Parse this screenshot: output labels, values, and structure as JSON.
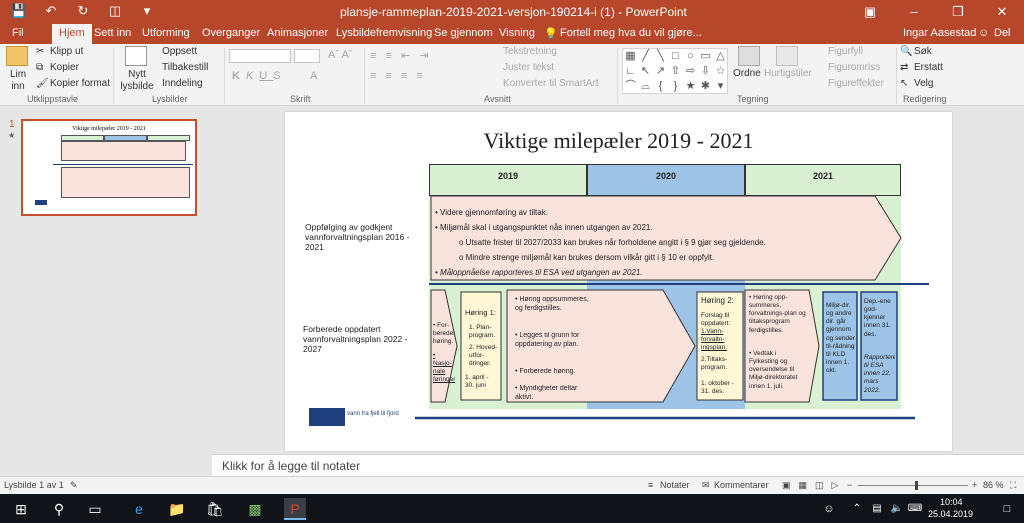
{
  "titlebar": {
    "title": "plansje-rammeplan-2019-2021-versjon-190214-i (1) - PowerPoint",
    "qat": [
      "save-icon",
      "undo-icon",
      "redo-icon",
      "slideshow-icon",
      "more-icon"
    ],
    "user": "Ingar Aasestad",
    "share": "Del"
  },
  "tabs": [
    "Fil",
    "Hjem",
    "Sett inn",
    "Utforming",
    "Overganger",
    "Animasjoner",
    "Lysbildefremvisning",
    "Se gjennom",
    "Visning"
  ],
  "tell_me": "Fortell meg hva du vil gjøre...",
  "ribbon": {
    "clipboard": {
      "paste": "Lim inn",
      "cut": "Klipp ut",
      "copy": "Kopier",
      "format": "Kopier format",
      "label": "Utklippstavle"
    },
    "slides": {
      "new": "Nytt lysbilde",
      "layout": "Oppsett",
      "reset": "Tilbakestill",
      "section": "Inndeling",
      "label": "Lysbilder"
    },
    "font": {
      "label": "Skrift"
    },
    "paragraph": {
      "direction": "Tekstretning",
      "align": "Juster tekst",
      "smartart": "Konverter til SmartArt",
      "label": "Avsnitt"
    },
    "drawing": {
      "arrange": "Ordne",
      "styles": "Hurtigstiler",
      "fill": "Figurfyll",
      "outline": "Figuromriss",
      "effects": "Figureffekter",
      "label": "Tegning"
    },
    "editing": {
      "find": "Søk",
      "replace": "Erstatt",
      "select": "Velg",
      "label": "Redigering"
    }
  },
  "thumbnail": {
    "number": "1",
    "title": "Viktige milepæler 2019 - 2021"
  },
  "slide": {
    "title": "Viktige milepæler 2019 - 2021",
    "years": [
      "2019",
      "2020",
      "2021"
    ],
    "row1_label": "Oppfølging av godkjent vannforvaltningsplan 2016 - 2021",
    "row1_bullets": [
      "• Videre gjennomføring av tiltak.",
      "• Miljømål skal i utgangspunktet nås innen utgangen av 2021.",
      "o   Utsatte frister til 2027/2033 kan brukes når forholdene angitt i § 9 gjør seg gjeldende.",
      "o   Mindre strenge miljømål kan brukes dersom vilkår gitt i § 10 er oppfylt.",
      "• Måloppnåelse rapporteres til ESA ved utgangen av 2021."
    ],
    "row2_label": "Forberede oppdatert vannforvaltningsplan 2022 - 2027",
    "cells": {
      "c1a": "• For-beredende høring.",
      "c1b": "• Nasjo-nale føringer.",
      "c2_title": "Høring 1:",
      "c2_items": [
        "1. Plan-program.",
        "2. Hoved-utfor-dringer.",
        "1. april - 30. juni"
      ],
      "c3": [
        "• Høring oppsummeres, og ferdigstilles.",
        "• Legges til grunn for oppdatering av plan.",
        "• Forberede høring.",
        "• Myndigheter deltar aktivt."
      ],
      "c4_title": "Høring 2:",
      "c4_items": [
        "Forslag til oppdatert:",
        "1.Vann-forvaltn-ingsplan.",
        "2.Tiltaks-program.",
        "1. oktober - 31. des."
      ],
      "c5": [
        "• Høring opp-summeres, forvaltnings-plan og tiltaksprogram ferdigstilles.",
        "• Vedtak i Fylkesting og oversendelse til Miljø-direktoratet innen 1. juli."
      ],
      "c6": "Miljø-dir. og andre dir. går gjennom og sender til-rådning til KLD innen 1. okt.",
      "c7a": "Dep.-ene god-kjenner innen 31. des.",
      "c7b": "Rapporteres til ESA innen 22. mars 2022."
    },
    "logo_text": "vann fra fjell til fjord"
  },
  "notes": "Klikk for å legge til notater",
  "status": {
    "slide": "Lysbilde 1 av 1",
    "notes_btn": "Notater",
    "comments_btn": "Kommentarer",
    "zoom": "86 %"
  },
  "taskbar": {
    "time": "10:04",
    "date": "25.04.2019"
  },
  "colors": {
    "accent": "#b7472a",
    "green": "#d9f0d3",
    "blue": "#9dc3e6",
    "pink": "#fbe3dd",
    "yellow": "#fff7d6",
    "navy": "#1f3f7f"
  }
}
